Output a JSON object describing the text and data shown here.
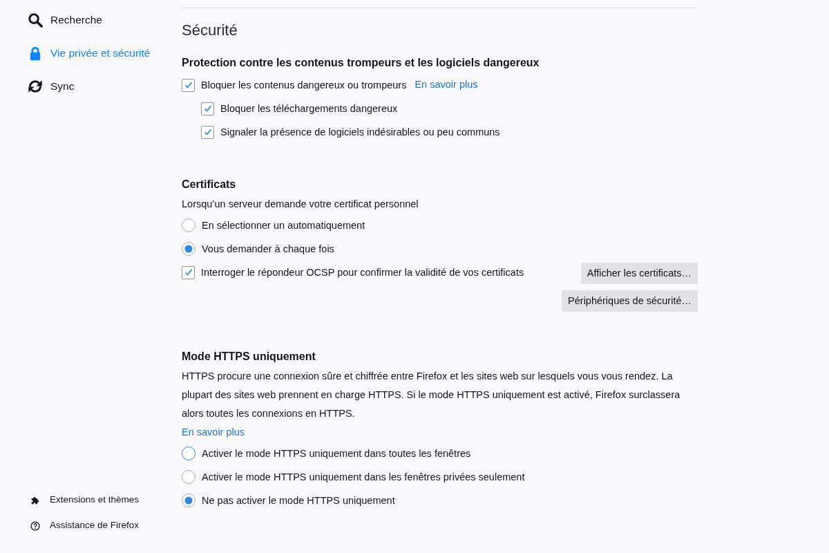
{
  "sidebar": {
    "nav_items": [
      {
        "label": "Recherche",
        "selected": false
      },
      {
        "label": "Vie privée et sécurité",
        "selected": true
      },
      {
        "label": "Sync",
        "selected": false
      }
    ],
    "footer_links": [
      {
        "label": "Extensions et thèmes"
      },
      {
        "label": "Assistance de Firefox"
      }
    ]
  },
  "content": {
    "page_title": "Sécurité",
    "groups": [
      {
        "heading": "Protection contre les contenus trompeurs et les logiciels dangereux",
        "controls": [
          {
            "kind": "checkbox",
            "label": "Bloquer les contenus dangereux ou trompeurs",
            "checked": true,
            "link": "En savoir plus",
            "children": [
              {
                "kind": "checkbox",
                "label": "Bloquer les téléchargements dangereux",
                "checked": true
              },
              {
                "kind": "checkbox",
                "label": "Signaler la présence de logiciels indésirables ou peu communs",
                "checked": true
              }
            ]
          }
        ]
      },
      {
        "heading": "Certificats",
        "controls": [
          {
            "kind": "text",
            "text": "Lorsqu’un serveur demande votre certificat personnel"
          },
          {
            "kind": "radio",
            "label": "En sélectionner un automatiquement",
            "selected": false,
            "focused": false
          },
          {
            "kind": "radio",
            "label": "Vous demander à chaque fois",
            "selected": true,
            "focused": false
          },
          {
            "kind": "checkbox",
            "label": "Interroger le répondeur OCSP pour confirmer la validité de vos certificats",
            "checked": true
          }
        ],
        "buttons": [
          {
            "label": "Afficher les certificats…"
          },
          {
            "label": "Périphériques de sécurité…"
          }
        ]
      },
      {
        "heading": "Mode HTTPS uniquement",
        "controls": [
          {
            "kind": "text",
            "text": "HTTPS procure une connexion sûre et chiffrée entre Firefox et les sites web sur lesquels vous vous rendez. La plupart des sites web prennent en charge HTTPS. Si le mode HTTPS uniquement est activé, Firefox surclassera alors toutes les connexions en HTTPS."
          },
          {
            "kind": "link",
            "text": "En savoir plus"
          },
          {
            "kind": "radio",
            "label": "Activer le mode HTTPS uniquement dans toutes les fenêtres",
            "selected": false,
            "focused": true
          },
          {
            "kind": "radio",
            "label": "Activer le mode HTTPS uniquement dans les fenêtres privées seulement",
            "selected": false,
            "focused": false
          },
          {
            "kind": "radio",
            "label": "Ne pas activer le mode HTTPS uniquement",
            "selected": true,
            "focused": false
          }
        ]
      }
    ]
  }
}
